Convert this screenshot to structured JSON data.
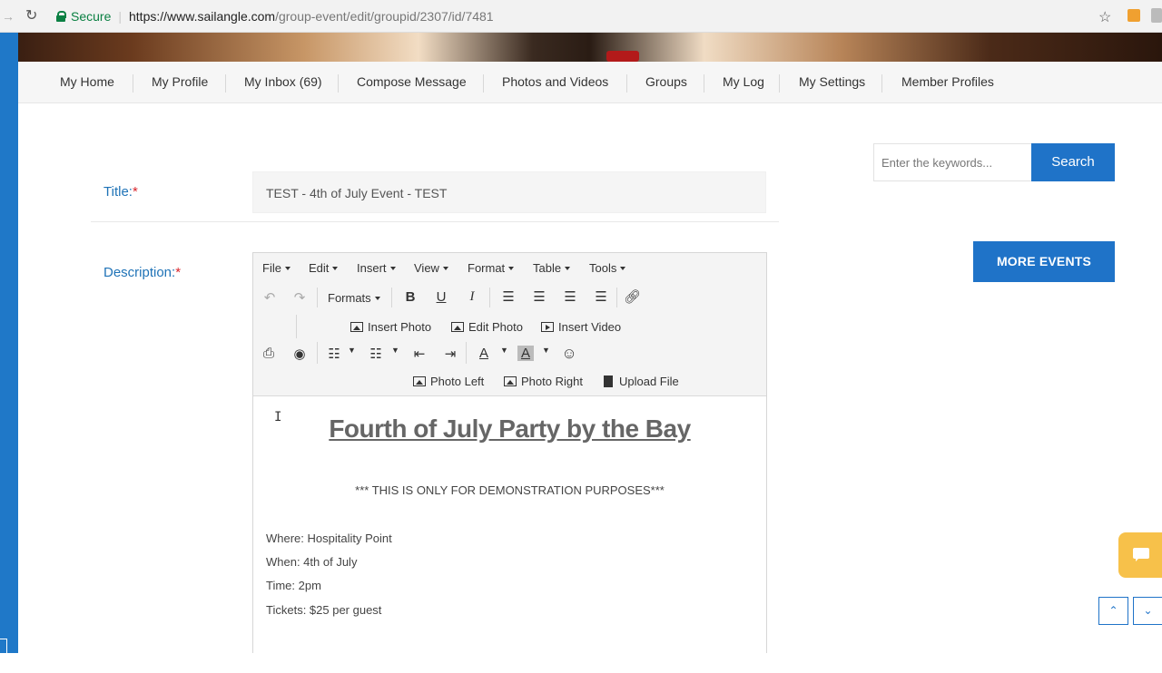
{
  "browser": {
    "secure_label": "Secure",
    "url_host": "https://www.sailangle.com",
    "url_path": "/group-event/edit/groupid/2307/id/7481"
  },
  "nav": {
    "items": [
      "My Home",
      "My Profile",
      "My Inbox (69)",
      "Compose Message",
      "Photos and Videos",
      "Groups",
      "My Log",
      "My Settings",
      "Member Profiles"
    ]
  },
  "form": {
    "title_label": "Title:",
    "required_mark": "*",
    "title_value": "TEST - 4th of July Event - TEST",
    "description_label": "Description:"
  },
  "sidebar": {
    "search_placeholder": "Enter the keywords...",
    "search_button": "Search",
    "more_events_button": "MORE EVENTS"
  },
  "editor": {
    "menu": [
      "File",
      "Edit",
      "Insert",
      "View",
      "Format",
      "Table",
      "Tools"
    ],
    "formats_label": "Formats",
    "bold": "B",
    "underline": "U",
    "italic": "I",
    "insert_photo": "Insert Photo",
    "edit_photo": "Edit Photo",
    "insert_video": "Insert Video",
    "photo_left": "Photo Left",
    "photo_right": "Photo Right",
    "upload_file": "Upload File",
    "text_color_letter": "A",
    "bg_color_letter": "A"
  },
  "document": {
    "heading": "Fourth of July Party by the Bay",
    "note": "*** THIS IS ONLY FOR DEMONSTRATION PURPOSES***",
    "lines": [
      "Where: Hospitality Point",
      "When: 4th of July",
      "Time: 2pm",
      "Tickets: $25 per guest"
    ]
  },
  "icons": {
    "undo": "undo-icon",
    "redo": "redo-icon",
    "link": "link-icon",
    "print": "print-icon",
    "preview": "eye-icon",
    "emoticon": "smiley-icon",
    "chat": "chat-icon"
  },
  "colors": {
    "accent": "#1f73c8",
    "label": "#1f73b7",
    "required": "#d9262c",
    "chat": "#f7c14a",
    "secure": "#0b8043"
  }
}
